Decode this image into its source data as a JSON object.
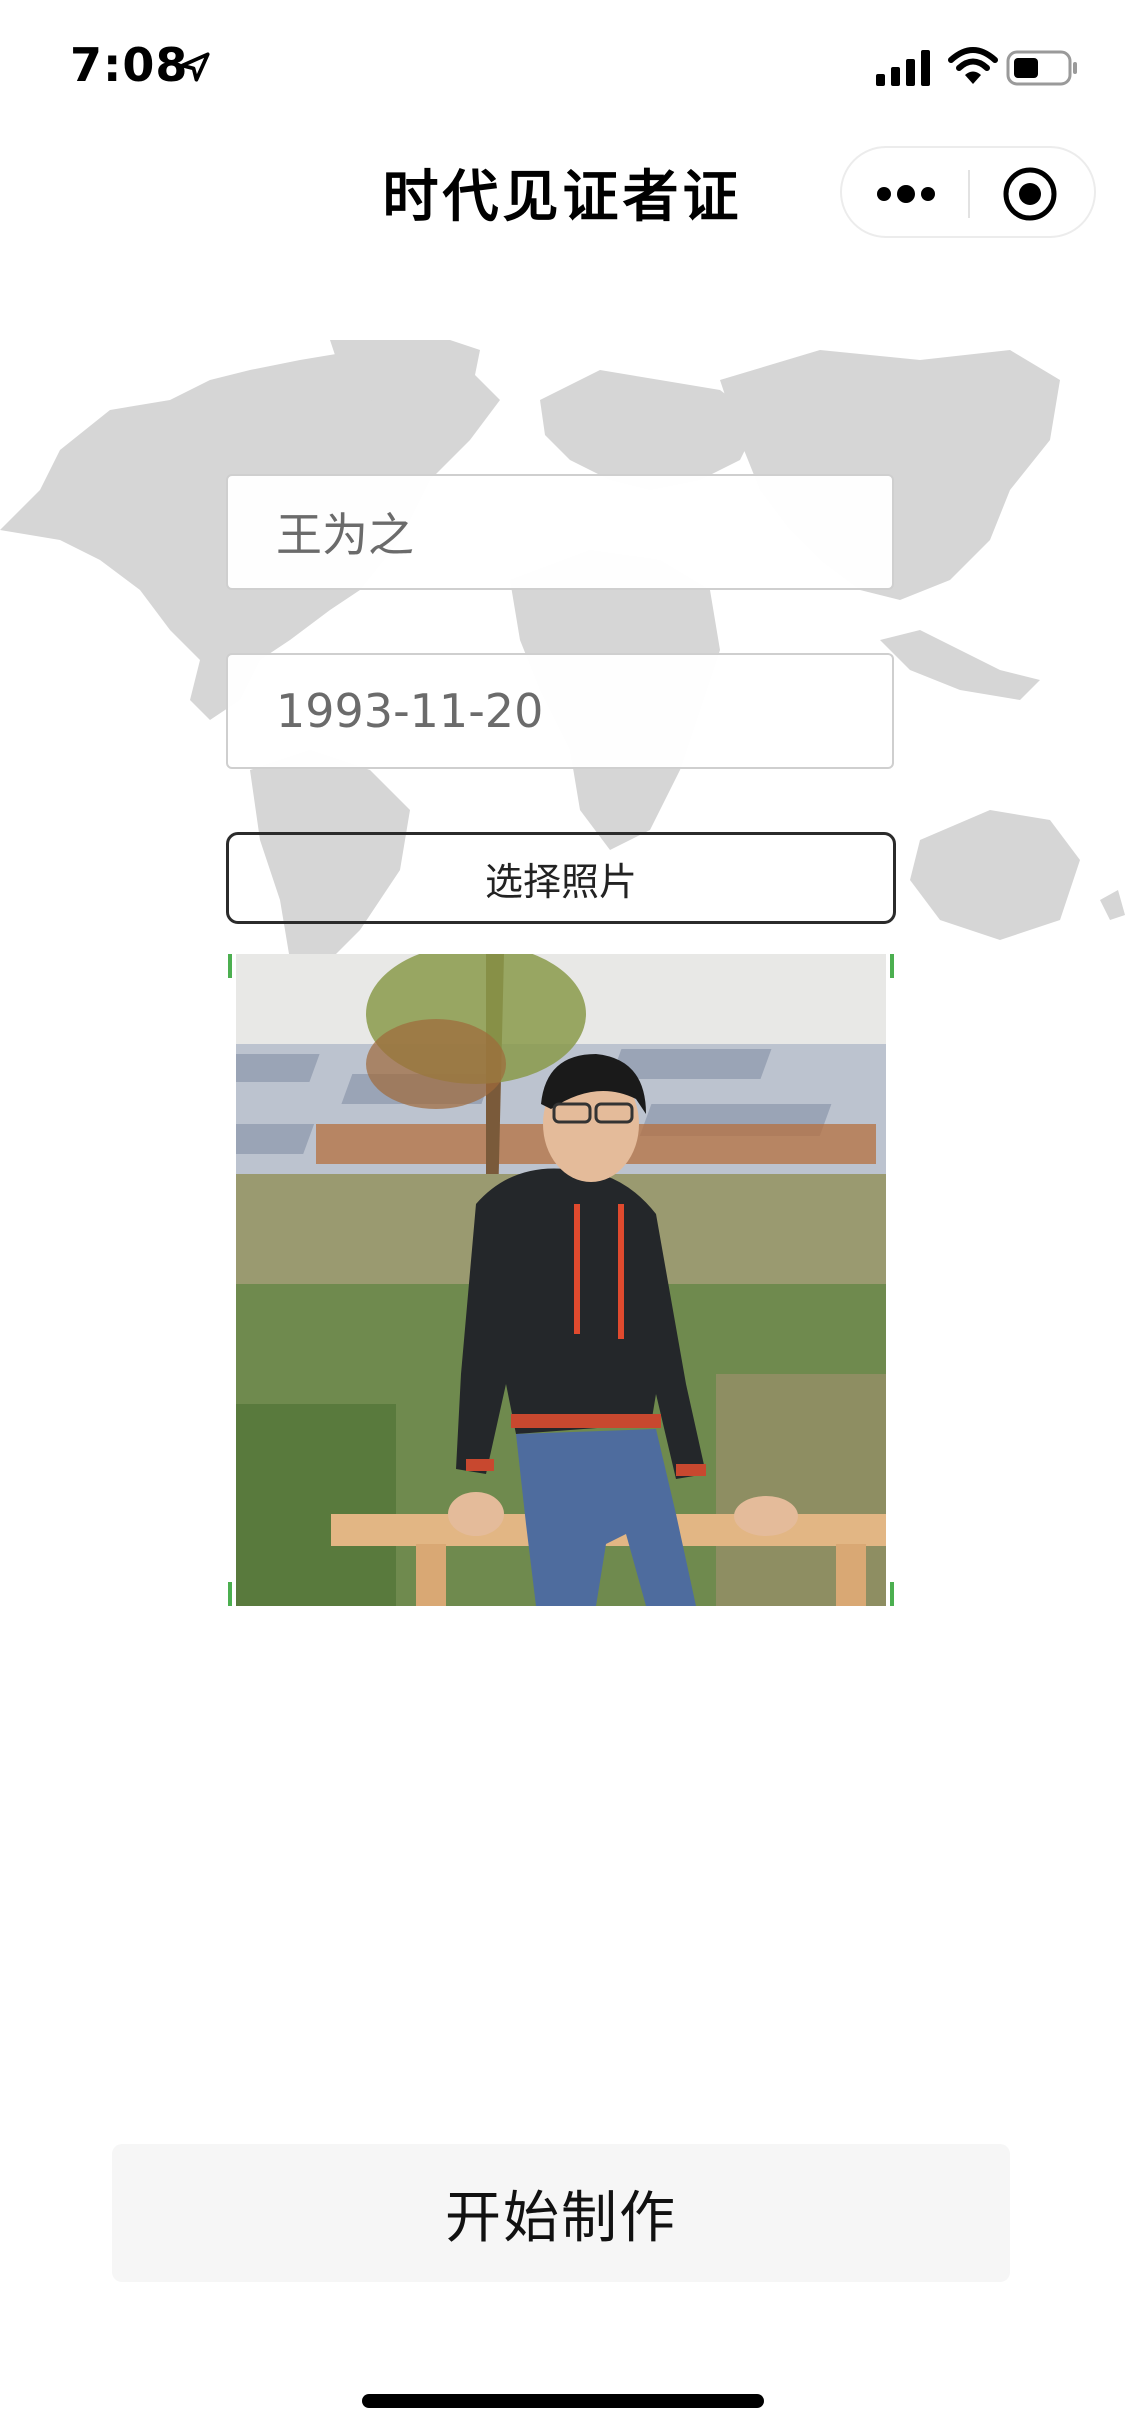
{
  "status_bar": {
    "time": "7:08",
    "icons": [
      "location-arrow-icon",
      "signal-bars-icon",
      "wifi-icon",
      "battery-icon"
    ]
  },
  "nav": {
    "title": "时代见证者证",
    "capsule_icons": [
      "more-dots-icon",
      "close-target-icon"
    ]
  },
  "form": {
    "name_value": "王为之",
    "birthdate_value": "1993-11-20",
    "choose_photo_label": "选择照片"
  },
  "photo": {
    "image": "selected-photo"
  },
  "actions": {
    "start_label": "开始制作"
  },
  "colors": {
    "map_gray": "#d6d6d6",
    "corner_green": "#4caf50",
    "button_bg": "#f6f6f6"
  }
}
